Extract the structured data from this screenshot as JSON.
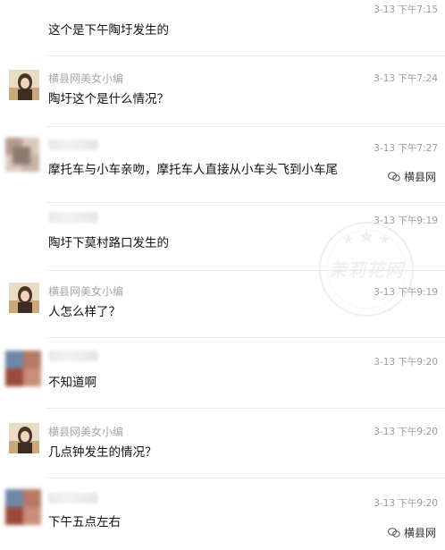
{
  "messages": [
    {
      "name": "",
      "time": "3-13 下午7:15",
      "text": "这个是下午陶圩发生的"
    },
    {
      "name": "横县网美女小编",
      "time": "3-13 下午7:24",
      "text": "陶圩这个是什么情况？"
    },
    {
      "name": "",
      "time": "3-13 下午7:27",
      "text": "摩托车与小车亲吻，摩托车人直接从小车头飞到小车尾"
    },
    {
      "name": "",
      "time": "3-13 下午9:19",
      "text": "陶圩下莫村路口发生的"
    },
    {
      "name": "横县网美女小编",
      "time": "3-13 下午9:19",
      "text": "人怎么样了？"
    },
    {
      "name": "",
      "time": "3-13 下午9:20",
      "text": "不知道啊"
    },
    {
      "name": "横县网美女小编",
      "time": "3-13 下午9:20",
      "text": "几点钟发生的情况？"
    },
    {
      "name": "",
      "time": "3-13 下午9:20",
      "text": "下午五点左右"
    }
  ],
  "watermark_small": {
    "label": "横县网"
  },
  "watermark_bottom": {
    "label": "横县网"
  },
  "watermark_big": {
    "label": "茉莉花网"
  },
  "colors": {
    "time": "#9b9b9b",
    "name": "#a6a6a6",
    "divider": "#ececec"
  }
}
